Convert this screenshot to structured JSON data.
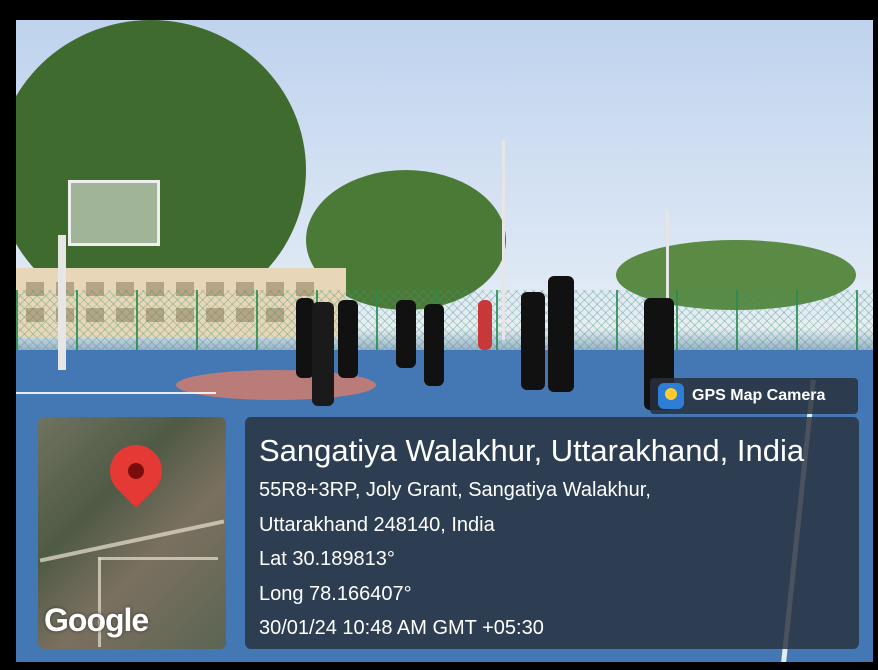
{
  "stamp": {
    "app_name": "GPS Map Camera",
    "place_title": "Sangatiya Walakhur, Uttarakhand, India",
    "address_line1": "55R8+3RP, Joly Grant, Sangatiya Walakhur,",
    "address_line2": "Uttarakhand 248140, India",
    "latitude": "Lat 30.189813°",
    "longitude": "Long 78.166407°",
    "datetime": "30/01/24 10:48 AM GMT +05:30"
  },
  "map": {
    "logo_text": "Google",
    "pin_color": "#e53935"
  },
  "colors": {
    "court_blue": "#4478b4",
    "card_bg": "#28303c"
  }
}
